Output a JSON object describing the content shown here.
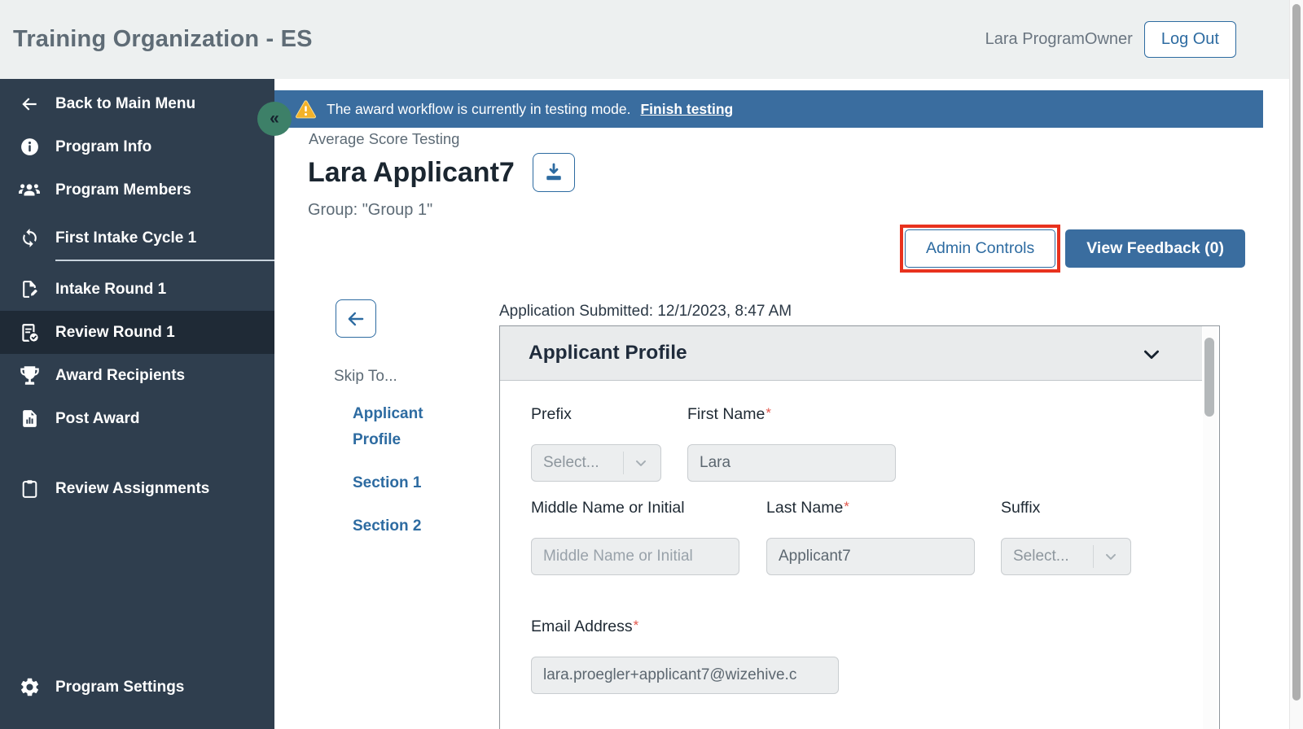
{
  "header": {
    "app_title": "Training Organization - ES",
    "user_name": "Lara ProgramOwner",
    "logout_label": "Log Out"
  },
  "sidebar": {
    "collapse_glyph": "«",
    "items": [
      {
        "label": "Back to Main Menu",
        "icon": "arrow-left-icon"
      },
      {
        "label": "Program Info",
        "icon": "info-icon"
      },
      {
        "label": "Program Members",
        "icon": "people-icon"
      },
      {
        "label": "First Intake Cycle 1",
        "icon": "cycle-icon"
      },
      {
        "label": "Intake Round 1",
        "icon": "document-edit-icon"
      },
      {
        "label": "Review Round 1",
        "icon": "document-check-icon",
        "active": true
      },
      {
        "label": "Award Recipients",
        "icon": "trophy-icon"
      },
      {
        "label": "Post Award",
        "icon": "document-chart-icon"
      },
      {
        "label": "Review Assignments",
        "icon": "clipboard-icon"
      },
      {
        "label": "Program Settings",
        "icon": "gear-icon"
      }
    ]
  },
  "banner": {
    "message": "The award workflow is currently in testing mode.",
    "action_label": "Finish testing"
  },
  "page": {
    "program_name": "Average Score Testing",
    "applicant_name": "Lara Applicant7",
    "group_label": "Group: \"Group 1\"",
    "admin_controls_label": "Admin Controls",
    "view_feedback_label": "View Feedback (0)",
    "submitted_text": "Application Submitted: 12/1/2023, 8:47 AM",
    "skip_to_label": "Skip To...",
    "skip_links": [
      "Applicant Profile",
      "Section 1",
      "Section 2"
    ]
  },
  "form": {
    "section_title": "Applicant Profile",
    "required_marker": "*",
    "prefix": {
      "label": "Prefix",
      "value": "Select..."
    },
    "first_name": {
      "label": "First Name",
      "value": "Lara"
    },
    "middle_name": {
      "label": "Middle Name or Initial",
      "placeholder": "Middle Name or Initial"
    },
    "last_name": {
      "label": "Last Name",
      "value": "Applicant7"
    },
    "suffix": {
      "label": "Suffix",
      "value": "Select..."
    },
    "email": {
      "label": "Email Address",
      "value": "lara.proegler+applicant7@wizehive.c"
    }
  },
  "colors": {
    "accent_blue": "#2D6BA1",
    "banner_blue": "#3A6D9F",
    "sidebar_navy": "#2F3E4E",
    "sidebar_active": "#1F2A36",
    "collapse_green": "#3D8068",
    "annotation_red": "#E8321E",
    "warning_yellow": "#F3B229"
  }
}
